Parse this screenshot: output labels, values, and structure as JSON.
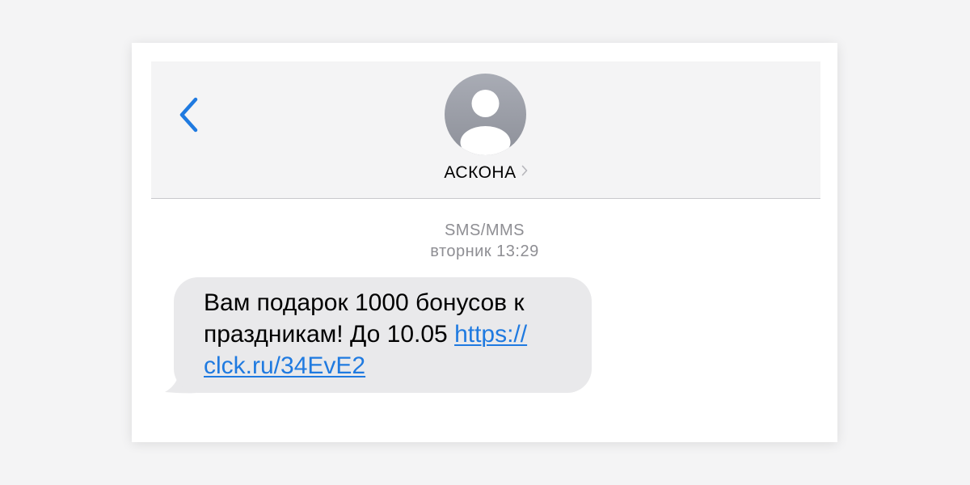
{
  "contact": {
    "name": "АСКОНА"
  },
  "thread": {
    "service_label": "SMS/MMS",
    "timestamp": "вторник 13:29"
  },
  "message": {
    "text_before_link": "Вам подарок 1000 бонусов к праздникам! До 10.05 ",
    "link_line_1": "https://",
    "link_line_2": "clck.ru/34EvE2"
  },
  "colors": {
    "accent_blue": "#1f7ae0",
    "bubble_gray": "#e9e9eb",
    "header_bg": "#f4f4f5",
    "meta_text": "#8e8e93"
  },
  "icons": {
    "back": "chevron-left-icon",
    "avatar": "person-silhouette-icon",
    "details": "chevron-right-icon"
  }
}
